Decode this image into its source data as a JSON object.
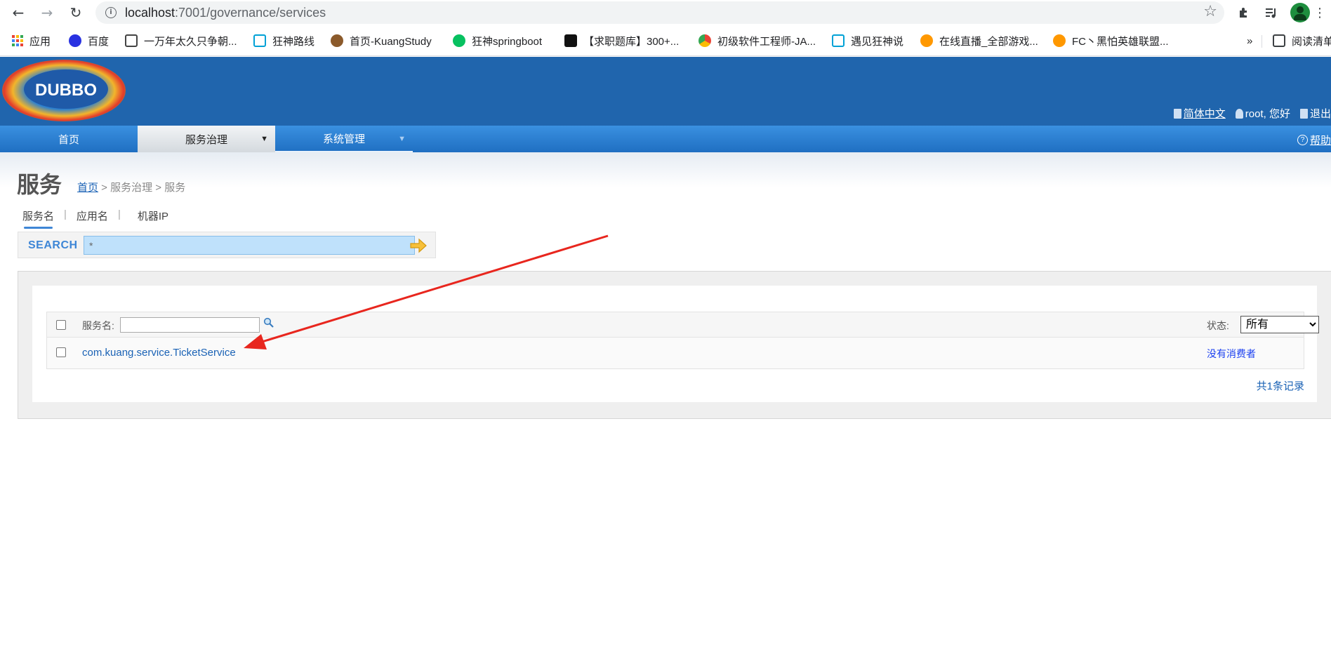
{
  "browser": {
    "url_host": "localhost",
    "url_path": ":7001/governance/services",
    "bookmarks": [
      {
        "label": "应用",
        "color": "#ea4335"
      },
      {
        "label": "百度",
        "color": "#2932e1"
      },
      {
        "label": "一万年太久只争朝...",
        "color": "#444444"
      },
      {
        "label": "狂神路线",
        "color": "#00a1d6"
      },
      {
        "label": "首页-KuangStudy",
        "color": "#8b5a2b"
      },
      {
        "label": "狂神springboot",
        "color": "#07c160"
      },
      {
        "label": "【求职题库】300+...",
        "color": "#111111"
      },
      {
        "label": "初级软件工程师-JA...",
        "color": "#f4b400"
      },
      {
        "label": "遇见狂神说",
        "color": "#00a1d6"
      },
      {
        "label": "在线直播_全部游戏...",
        "color": "#ff9800"
      },
      {
        "label": "FC丶黑怕英雄联盟...",
        "color": "#ff9800"
      }
    ],
    "more": "»",
    "reading_list": "阅读清单"
  },
  "header": {
    "logo_text": "DUBBO",
    "lang": "简体中文",
    "user": "root, 您好",
    "logout": "退出"
  },
  "menu": {
    "home": "首页",
    "governance": "服务治理",
    "system": "系统管理",
    "help": "帮助"
  },
  "page": {
    "title": "服务",
    "breadcrumb_home": "首页",
    "breadcrumb_rest": " > 服务治理 > 服务"
  },
  "search": {
    "tabs": [
      "服务名",
      "应用名",
      "机器IP"
    ],
    "label": "SEARCH",
    "value": "*"
  },
  "table": {
    "filter_label": "服务名:",
    "status_label": "状态:",
    "status_selected": "所有",
    "rows": [
      {
        "service": "com.kuang.service.TicketService",
        "status": "没有消费者"
      }
    ],
    "total": "共1条记录"
  },
  "colors": {
    "header_bg": "#2065ad",
    "link": "#1a62b5",
    "annotation_arrow": "#e8261e"
  }
}
